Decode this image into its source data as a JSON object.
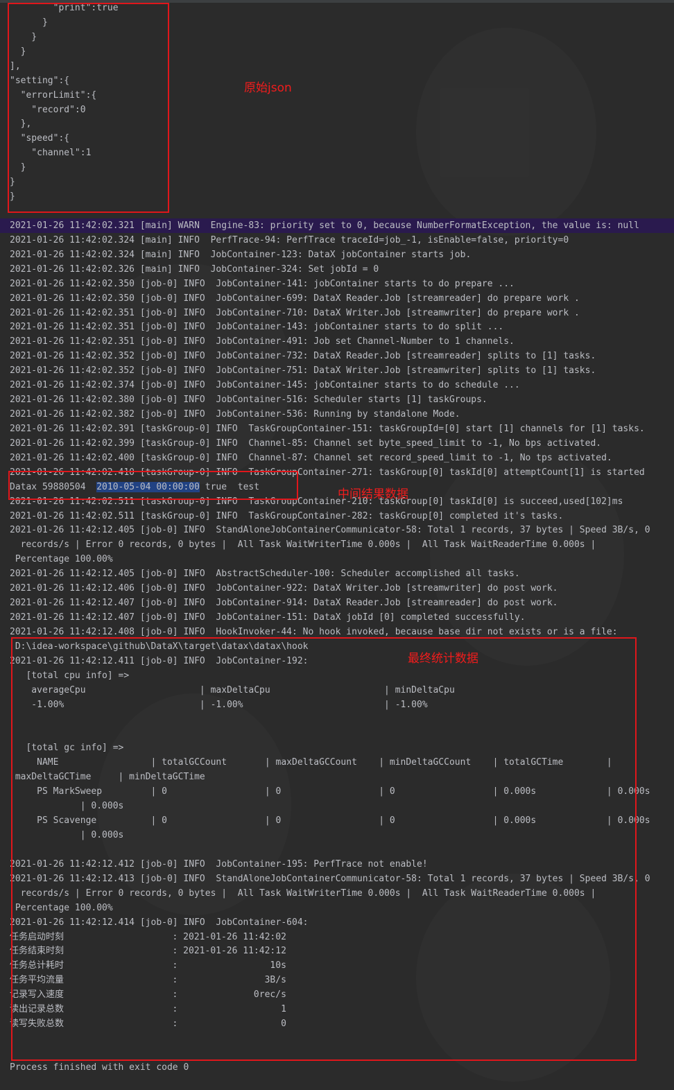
{
  "json_lines": [
    "        \"print\":true",
    "      }",
    "    }",
    "  }",
    "],",
    "\"setting\":{",
    "  \"errorLimit\":{",
    "    \"record\":0",
    "  },",
    "  \"speed\":{",
    "    \"channel\":1",
    "  }",
    "}",
    "}"
  ],
  "log_lines": [
    "2021-01-26 11:42:02.321 [main] WARN  Engine-83: priority set to 0, because NumberFormatException, the value is: null",
    "2021-01-26 11:42:02.324 [main] INFO  PerfTrace-94: PerfTrace traceId=job_-1, isEnable=false, priority=0",
    "2021-01-26 11:42:02.324 [main] INFO  JobContainer-123: DataX jobContainer starts job.",
    "2021-01-26 11:42:02.326 [main] INFO  JobContainer-324: Set jobId = 0",
    "2021-01-26 11:42:02.350 [job-0] INFO  JobContainer-141: jobContainer starts to do prepare ...",
    "2021-01-26 11:42:02.350 [job-0] INFO  JobContainer-699: DataX Reader.Job [streamreader] do prepare work .",
    "2021-01-26 11:42:02.351 [job-0] INFO  JobContainer-710: DataX Writer.Job [streamwriter] do prepare work .",
    "2021-01-26 11:42:02.351 [job-0] INFO  JobContainer-143: jobContainer starts to do split ...",
    "2021-01-26 11:42:02.351 [job-0] INFO  JobContainer-491: Job set Channel-Number to 1 channels.",
    "2021-01-26 11:42:02.352 [job-0] INFO  JobContainer-732: DataX Reader.Job [streamreader] splits to [1] tasks.",
    "2021-01-26 11:42:02.352 [job-0] INFO  JobContainer-751: DataX Writer.Job [streamwriter] splits to [1] tasks.",
    "2021-01-26 11:42:02.374 [job-0] INFO  JobContainer-145: jobContainer starts to do schedule ...",
    "2021-01-26 11:42:02.380 [job-0] INFO  JobContainer-516: Scheduler starts [1] taskGroups.",
    "2021-01-26 11:42:02.382 [job-0] INFO  JobContainer-536: Running by standalone Mode.",
    "2021-01-26 11:42:02.391 [taskGroup-0] INFO  TaskGroupContainer-151: taskGroupId=[0] start [1] channels for [1] tasks.",
    "2021-01-26 11:42:02.399 [taskGroup-0] INFO  Channel-85: Channel set byte_speed_limit to -1, No bps activated.",
    "2021-01-26 11:42:02.400 [taskGroup-0] INFO  Channel-87: Channel set record_speed_limit to -1, No tps activated.",
    "2021-01-26 11:42:02.410 [taskGroup-0] INFO  TaskGroupContainer-271: taskGroup[0] taskId[0] attemptCount[1] is started",
    "",
    "2021-01-26 11:42:02.511 [taskGroup-0] INFO  TaskGroupContainer-210: taskGroup[0] taskId[0] is succeed,used[102]ms",
    "2021-01-26 11:42:02.511 [taskGroup-0] INFO  TaskGroupContainer-282: taskGroup[0] completed it's tasks.",
    "2021-01-26 11:42:12.405 [job-0] INFO  StandAloneJobContainerCommunicator-58: Total 1 records, 37 bytes | Speed 3B/s, 0",
    "  records/s | Error 0 records, 0 bytes |  All Task WaitWriterTime 0.000s |  All Task WaitReaderTime 0.000s |",
    " Percentage 100.00%",
    "2021-01-26 11:42:12.405 [job-0] INFO  AbstractScheduler-100: Scheduler accomplished all tasks.",
    "2021-01-26 11:42:12.406 [job-0] INFO  JobContainer-922: DataX Writer.Job [streamwriter] do post work.",
    "2021-01-26 11:42:12.407 [job-0] INFO  JobContainer-914: DataX Reader.Job [streamreader] do post work.",
    "2021-01-26 11:42:12.407 [job-0] INFO  JobContainer-151: DataX jobId [0] completed successfully.",
    "2021-01-26 11:42:12.408 [job-0] INFO  HookInvoker-44: No hook invoked, because base dir not exists or is a file:",
    " D:\\idea-workspace\\github\\DataX\\target\\datax\\datax\\hook",
    "2021-01-26 11:42:12.411 [job-0] INFO  JobContainer-192: ",
    "   [total cpu info] => ",
    "    averageCpu                     | maxDeltaCpu                     | minDeltaCpu                    ",
    "    -1.00%                         | -1.00%                          | -1.00%",
    "",
    "",
    "   [total gc info] => ",
    "     NAME                 | totalGCCount       | maxDeltaGCCount    | minDeltaGCCount    | totalGCTime        |",
    " maxDeltaGCTime     | minDeltaGCTime     ",
    "     PS MarkSweep         | 0                  | 0                  | 0                  | 0.000s             | 0.000s",
    "             | 0.000s             ",
    "     PS Scavenge          | 0                  | 0                  | 0                  | 0.000s             | 0.000s",
    "             | 0.000s             ",
    "",
    "2021-01-26 11:42:12.412 [job-0] INFO  JobContainer-195: PerfTrace not enable!",
    "2021-01-26 11:42:12.413 [job-0] INFO  StandAloneJobContainerCommunicator-58: Total 1 records, 37 bytes | Speed 3B/s, 0",
    "  records/s | Error 0 records, 0 bytes |  All Task WaitWriterTime 0.000s |  All Task WaitReaderTime 0.000s |",
    " Percentage 100.00%",
    "2021-01-26 11:42:12.414 [job-0] INFO  JobContainer-604: ",
    "任务启动时刻                    : 2021-01-26 11:42:02",
    "任务结束时刻                    : 2021-01-26 11:42:12",
    "任务总计耗时                    :                 10s",
    "任务平均流量                    :                3B/s",
    "记录写入速度                    :              0rec/s",
    "读出记录总数                    :                   1",
    "读写失败总数                    :                   0",
    "",
    "",
    "Process finished with exit code 0"
  ],
  "datax_row": {
    "prefix": "Datax 59880504  ",
    "selected": "2010-05-04 00:00:00",
    "suffix": " true  test"
  },
  "annotations": {
    "json_note": "原始json",
    "middle_note": "中间结果数据",
    "final_note": "最终统计数据"
  },
  "colors": {
    "background": "#2b2b2b",
    "text": "#bcbec4",
    "warn_line": "#2a1a4e",
    "selection": "#214283",
    "annotation": "#e0161b"
  }
}
